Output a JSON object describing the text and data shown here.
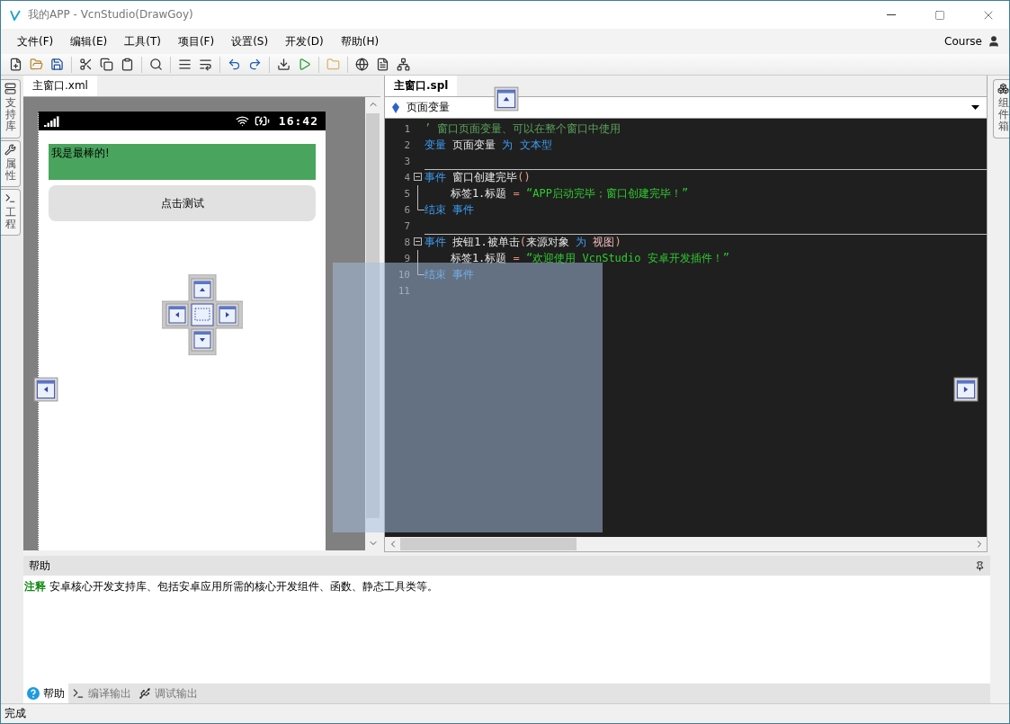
{
  "window": {
    "title": "我的APP - VcnStudio(DrawGoy)"
  },
  "menu": [
    "文件(F)",
    "编辑(E)",
    "工具(T)",
    "项目(F)",
    "设置(S)",
    "开发(D)",
    "帮助(H)"
  ],
  "account": {
    "name": "Course"
  },
  "left_dock_tabs": [
    {
      "label": "支持库"
    },
    {
      "label": "属性"
    },
    {
      "label": "工程"
    }
  ],
  "designer": {
    "tab": {
      "label": "主窗口.xml",
      "selected": true
    },
    "phone": {
      "time": "16:42",
      "label": "我是最棒的!",
      "button": "点击测试"
    }
  },
  "editor": {
    "tab": {
      "label": "主窗口.spl",
      "selected": true
    },
    "scope": "页面变量",
    "lines": [
      {
        "number": "1",
        "kind": "plain",
        "separator": false,
        "tokens": [
          {
            "kind": "comment",
            "text": "’ 窗口页面变量、可以在整个窗口中使用"
          }
        ]
      },
      {
        "number": "2",
        "kind": "plain",
        "separator": false,
        "tokens": [
          {
            "kind": "keyword",
            "text": "变量"
          },
          {
            "kind": "plain",
            "text": " 页面变量 "
          },
          {
            "kind": "keyword",
            "text": "为 文本型"
          }
        ]
      },
      {
        "number": "3",
        "kind": "plain",
        "separator": false
      },
      {
        "number": "4",
        "kind": "fold_start",
        "separator": true,
        "tokens": [
          {
            "kind": "keyword",
            "text": "事件"
          },
          {
            "kind": "plain",
            "text": " 窗口创建完毕"
          },
          {
            "kind": "paren",
            "text": "()"
          }
        ]
      },
      {
        "number": "5",
        "kind": "fold_body",
        "separator": false,
        "tokens": [
          {
            "kind": "plain",
            "text": "    标签1.标题 "
          },
          {
            "kind": "operator",
            "text": "="
          },
          {
            "kind": "string",
            "text": " “APP启动完毕；窗口创建完毕！”"
          }
        ]
      },
      {
        "number": "6",
        "kind": "fold_end",
        "separator": false,
        "tokens": [
          {
            "kind": "keyword",
            "text": "结束 事件"
          }
        ]
      },
      {
        "number": "7",
        "kind": "plain",
        "separator": false
      },
      {
        "number": "8",
        "kind": "fold_start",
        "separator": true,
        "tokens": [
          {
            "kind": "keyword",
            "text": "事件"
          },
          {
            "kind": "plain",
            "text": " 按钮1.被单击"
          },
          {
            "kind": "paren",
            "text": "("
          },
          {
            "kind": "plain",
            "text": "来源对象 "
          },
          {
            "kind": "keyword",
            "text": "为"
          },
          {
            "kind": "type",
            "text": " 视图"
          },
          {
            "kind": "paren",
            "text": ")"
          }
        ]
      },
      {
        "number": "9",
        "kind": "fold_body",
        "separator": false,
        "tokens": [
          {
            "kind": "plain",
            "text": "    标签1.标题 "
          },
          {
            "kind": "operator",
            "text": "="
          },
          {
            "kind": "string",
            "text": " “欢迎使用 VcnStudio 安卓开发插件！”"
          }
        ]
      },
      {
        "number": "10",
        "kind": "fold_end",
        "separator": false,
        "tokens": [
          {
            "kind": "keyword",
            "text": "结束 事件"
          }
        ]
      },
      {
        "number": "11",
        "kind": "plain",
        "separator": false
      }
    ]
  },
  "right_dock_tabs": [
    {
      "label": "组件箱"
    }
  ],
  "help": {
    "title": "帮助",
    "note": "**注释** 安卓核心开发支持库、包括安卓应用所需的核心开发组件、函数、静态工具类等。",
    "tabs": [
      {
        "label": "帮助",
        "selected": true
      },
      {
        "label": "编译输出",
        "selected": false
      },
      {
        "label": "调试输出",
        "selected": false
      }
    ]
  },
  "status_bar": {
    "text": "完成"
  }
}
